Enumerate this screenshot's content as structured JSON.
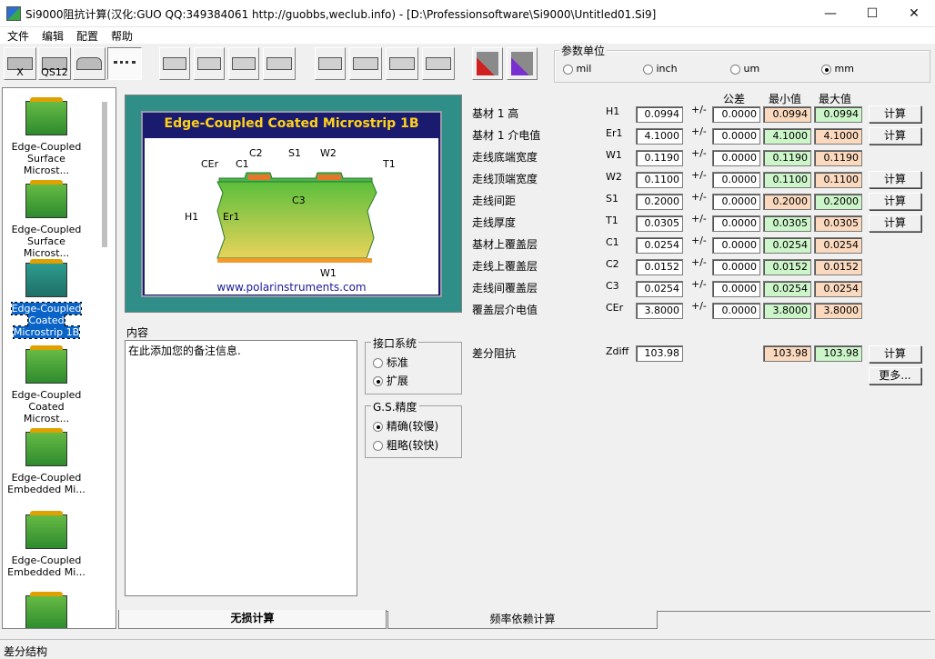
{
  "window": {
    "title": "Si9000阻抗计算(汉化:GUO QQ:349384061 http://guobbs,weclub.info) - [D:\\Professionsoftware\\Si9000\\Untitled01.Si9]",
    "minimize": "—",
    "maximize": "☐",
    "close": "✕"
  },
  "menu": [
    "文件",
    "编辑",
    "配置",
    "帮助"
  ],
  "toolbar": {
    "btn1": "X",
    "btn2": "QS12"
  },
  "units": {
    "title": "参数单位",
    "options": [
      "mil",
      "inch",
      "um",
      "mm"
    ],
    "selected": "mm"
  },
  "sidebar": {
    "items": [
      {
        "label": "Edge-Coupled Surface Microst..."
      },
      {
        "label": "Edge-Coupled Surface Microst..."
      },
      {
        "label": "Edge-Coupled Coated Microstrip 1B",
        "selected": true
      },
      {
        "label": "Edge-Coupled Coated Microst..."
      },
      {
        "label": "Edge-Coupled Embedded Mi..."
      },
      {
        "label": "Edge-Coupled Embedded Mi..."
      }
    ]
  },
  "figure": {
    "title": "Edge-Coupled Coated Microstrip 1B",
    "url": "www.polarinstruments.com",
    "labels": [
      "C2",
      "S1",
      "W2",
      "CEr",
      "C1",
      "T1",
      "C3",
      "H1",
      "Er1",
      "W1"
    ]
  },
  "notes": {
    "label": "内容",
    "text": "在此添加您的备注信息."
  },
  "interface": {
    "title": "接口系统",
    "options": [
      "标准",
      "扩展"
    ],
    "selected": "扩展"
  },
  "gs": {
    "title": "G.S.精度",
    "options": [
      "精确(较慢)",
      "粗略(较快)"
    ],
    "selected": "精确(较慢)"
  },
  "headers": {
    "tol": "公差",
    "min": "最小值",
    "max": "最大值"
  },
  "params": [
    {
      "name": "基材 1 高",
      "sym": "H1",
      "value": "0.0994",
      "pm": "+/-",
      "tol": "0.0000",
      "min": "0.0994",
      "max": "0.0994",
      "min_color": "#fbd9be",
      "max_color": "#ccf5c9",
      "calc": "计算"
    },
    {
      "name": "基材 1 介电值",
      "sym": "Er1",
      "value": "4.1000",
      "pm": "+/-",
      "tol": "0.0000",
      "min": "4.1000",
      "max": "4.1000",
      "min_color": "#ccf5c9",
      "max_color": "#fbd9be",
      "calc": "计算"
    },
    {
      "name": "走线底端宽度",
      "sym": "W1",
      "value": "0.1190",
      "pm": "+/-",
      "tol": "0.0000",
      "min": "0.1190",
      "max": "0.1190",
      "min_color": "#ccf5c9",
      "max_color": "#fbd9be",
      "calc": ""
    },
    {
      "name": "走线顶端宽度",
      "sym": "W2",
      "value": "0.1100",
      "pm": "+/-",
      "tol": "0.0000",
      "min": "0.1100",
      "max": "0.1100",
      "min_color": "#ccf5c9",
      "max_color": "#fbd9be",
      "calc": "计算"
    },
    {
      "name": "走线间距",
      "sym": "S1",
      "value": "0.2000",
      "pm": "+/-",
      "tol": "0.0000",
      "min": "0.2000",
      "max": "0.2000",
      "min_color": "#fbd9be",
      "max_color": "#ccf5c9",
      "calc": "计算"
    },
    {
      "name": "走线厚度",
      "sym": "T1",
      "value": "0.0305",
      "pm": "+/-",
      "tol": "0.0000",
      "min": "0.0305",
      "max": "0.0305",
      "min_color": "#ccf5c9",
      "max_color": "#fbd9be",
      "calc": "计算"
    },
    {
      "name": "基材上覆盖层",
      "sym": "C1",
      "value": "0.0254",
      "pm": "+/-",
      "tol": "0.0000",
      "min": "0.0254",
      "max": "0.0254",
      "min_color": "#ccf5c9",
      "max_color": "#fbd9be",
      "calc": ""
    },
    {
      "name": "走线上覆盖层",
      "sym": "C2",
      "value": "0.0152",
      "pm": "+/-",
      "tol": "0.0000",
      "min": "0.0152",
      "max": "0.0152",
      "min_color": "#ccf5c9",
      "max_color": "#fbd9be",
      "calc": ""
    },
    {
      "name": "走线间覆盖层",
      "sym": "C3",
      "value": "0.0254",
      "pm": "+/-",
      "tol": "0.0000",
      "min": "0.0254",
      "max": "0.0254",
      "min_color": "#ccf5c9",
      "max_color": "#fbd9be",
      "calc": ""
    },
    {
      "name": "覆盖层介电值",
      "sym": "CEr",
      "value": "3.8000",
      "pm": "+/-",
      "tol": "0.0000",
      "min": "3.8000",
      "max": "3.8000",
      "min_color": "#ccf5c9",
      "max_color": "#fbd9be",
      "calc": ""
    }
  ],
  "zdiff": {
    "name": "差分阻抗",
    "sym": "Zdiff",
    "value": "103.98",
    "min": "103.98",
    "max": "103.98",
    "min_color": "#fbd9be",
    "max_color": "#ccf5c9",
    "calc": "计算",
    "more": "更多..."
  },
  "tabs": [
    "无损计算",
    "频率依赖计算"
  ],
  "status": "差分结构"
}
